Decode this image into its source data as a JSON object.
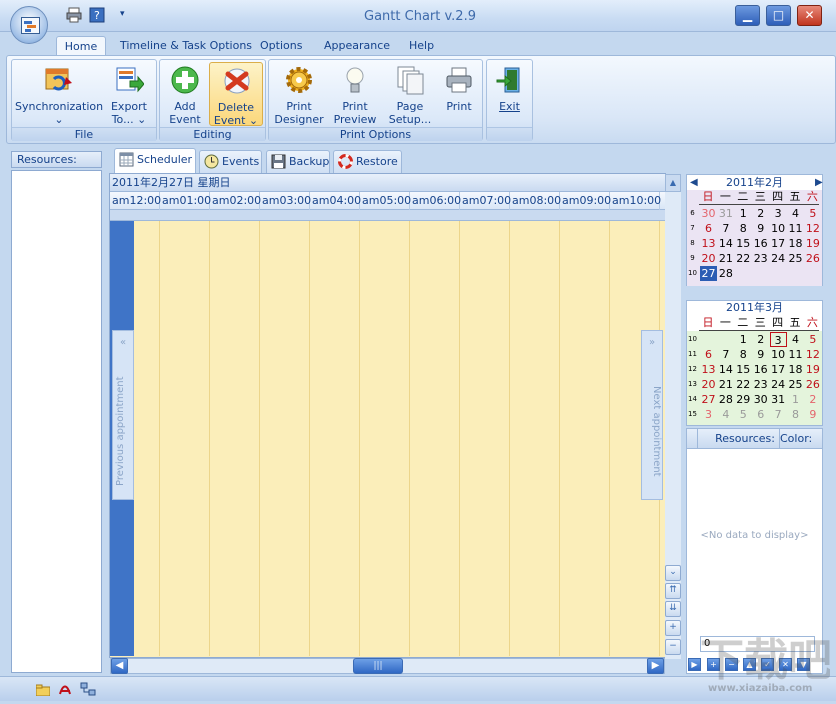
{
  "window": {
    "title": "Gantt Chart v.2.9",
    "minimize_label": "▁",
    "maximize_label": "□",
    "close_label": "✕"
  },
  "ribbon_tabs": [
    "Home",
    "Timeline & Task Options",
    "Options",
    "Appearance",
    "Help"
  ],
  "ribbon": {
    "groups": [
      "File",
      "Editing",
      "Print Options"
    ],
    "buttons": {
      "sync": {
        "line1": "Synchronization",
        "line2": "⌄"
      },
      "export": {
        "line1": "Export",
        "line2": "To... ⌄"
      },
      "add_event": {
        "line1": "Add",
        "line2": "Event"
      },
      "delete_event": {
        "line1": "Delete",
        "line2": "Event ⌄"
      },
      "print_designer": {
        "line1": "Print",
        "line2": "Designer"
      },
      "print_preview": {
        "line1": "Print",
        "line2": "Preview"
      },
      "page_setup": {
        "line1": "Page",
        "line2": "Setup..."
      },
      "print": {
        "line1": "Print",
        "line2": ""
      },
      "exit": {
        "line1": "Exit",
        "line2": ""
      }
    }
  },
  "left_panel": {
    "resources_label": "Resources:"
  },
  "scheduler_tabs": [
    "Scheduler",
    "Events",
    "Backup",
    "Restore"
  ],
  "scheduler": {
    "date_header": "2011年2月27日 星期日",
    "hours": [
      "am12:00",
      "am01:00",
      "am02:00",
      "am03:00",
      "am04:00",
      "am05:00",
      "am06:00",
      "am07:00",
      "am08:00",
      "am09:00",
      "am10:00"
    ],
    "prev_appointment": "Previous appointment",
    "next_appointment": "Next appointment",
    "prev_chevron": "«",
    "next_chevron": "»",
    "hscroll_thumb": "|||"
  },
  "calendar_feb": {
    "title": "2011年2月",
    "weekdays": [
      "日",
      "一",
      "二",
      "三",
      "四",
      "五",
      "六"
    ],
    "weeks": [
      {
        "wk": "6",
        "days": [
          "30",
          "31",
          "1",
          "2",
          "3",
          "4",
          "5"
        ]
      },
      {
        "wk": "7",
        "days": [
          "6",
          "7",
          "8",
          "9",
          "10",
          "11",
          "12"
        ]
      },
      {
        "wk": "8",
        "days": [
          "13",
          "14",
          "15",
          "16",
          "17",
          "18",
          "19"
        ]
      },
      {
        "wk": "9",
        "days": [
          "20",
          "21",
          "22",
          "23",
          "24",
          "25",
          "26"
        ]
      },
      {
        "wk": "10",
        "days": [
          "27",
          "28",
          "",
          "",
          "",
          "",
          ""
        ]
      }
    ],
    "big_number": "2"
  },
  "calendar_mar": {
    "title": "2011年3月",
    "weekdays": [
      "日",
      "一",
      "二",
      "三",
      "四",
      "五",
      "六"
    ],
    "weeks": [
      {
        "wk": "10",
        "days": [
          "",
          "",
          "1",
          "2",
          "3",
          "4",
          "5"
        ]
      },
      {
        "wk": "11",
        "days": [
          "6",
          "7",
          "8",
          "9",
          "10",
          "11",
          "12"
        ]
      },
      {
        "wk": "12",
        "days": [
          "13",
          "14",
          "15",
          "16",
          "17",
          "18",
          "19"
        ]
      },
      {
        "wk": "13",
        "days": [
          "20",
          "21",
          "22",
          "23",
          "24",
          "25",
          "26"
        ]
      },
      {
        "wk": "14",
        "days": [
          "27",
          "28",
          "29",
          "30",
          "31",
          "1",
          "2"
        ]
      },
      {
        "wk": "15",
        "days": [
          "3",
          "4",
          "5",
          "6",
          "7",
          "8",
          "9"
        ]
      }
    ],
    "big_number": "3"
  },
  "resources_grid": {
    "col_resources": "Resources:",
    "col_color": "Color:",
    "empty_text": "<No data to display>",
    "input_value": "0"
  },
  "watermark": "下载吧"
}
